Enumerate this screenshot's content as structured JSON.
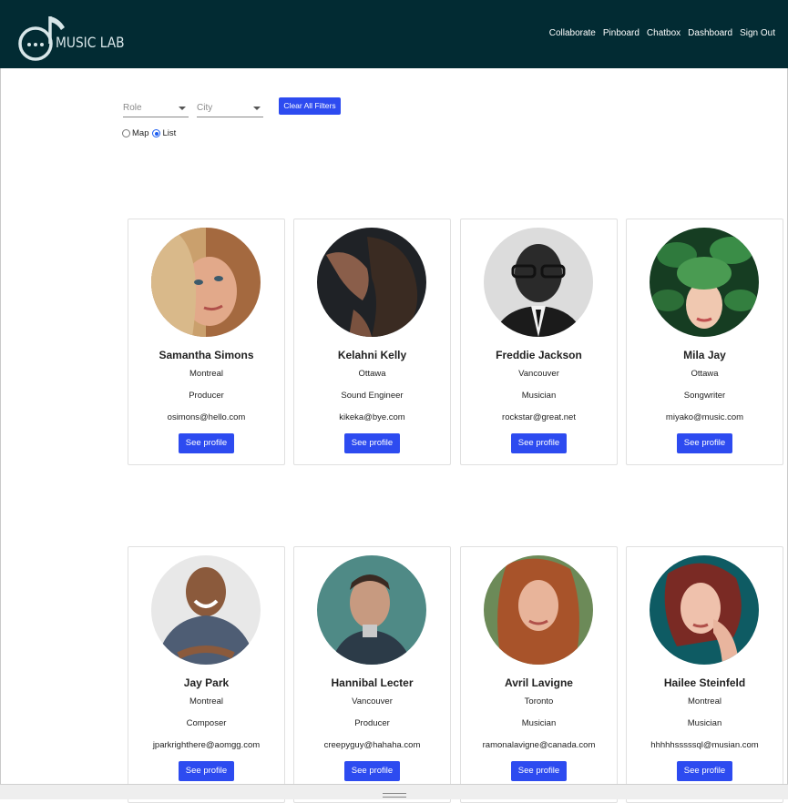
{
  "brand": {
    "name": "MUSIC LAB"
  },
  "nav": [
    {
      "label": "Collaborate"
    },
    {
      "label": "Pinboard"
    },
    {
      "label": "Chatbox"
    },
    {
      "label": "Dashboard"
    },
    {
      "label": "Sign Out"
    }
  ],
  "filters": {
    "role_label": "Role",
    "city_label": "City",
    "clear_label": "Clear All Filters",
    "view_options": [
      {
        "label": "Map",
        "selected": false
      },
      {
        "label": "List",
        "selected": true
      }
    ]
  },
  "cards": [
    {
      "name": "Samantha Simons",
      "city": "Montreal",
      "role": "Producer",
      "email": "osimons@hello.com",
      "button": "See profile"
    },
    {
      "name": "Kelahni Kelly",
      "city": "Ottawa",
      "role": "Sound Engineer",
      "email": "kikeka@bye.com",
      "button": "See profile"
    },
    {
      "name": "Freddie Jackson",
      "city": "Vancouver",
      "role": "Musician",
      "email": "rockstar@great.net",
      "button": "See profile"
    },
    {
      "name": "Mila Jay",
      "city": "Ottawa",
      "role": "Songwriter",
      "email": "miyako@music.com",
      "button": "See profile"
    },
    {
      "name": "Jay Park",
      "city": "Montreal",
      "role": "Composer",
      "email": "jparkrighthere@aomgg.com",
      "button": "See profile"
    },
    {
      "name": "Hannibal Lecter",
      "city": "Vancouver",
      "role": "Producer",
      "email": "creepyguy@hahaha.com",
      "button": "See profile"
    },
    {
      "name": "Avril Lavigne",
      "city": "Toronto",
      "role": "Musician",
      "email": "ramonalavigne@canada.com",
      "button": "See profile"
    },
    {
      "name": "Hailee Steinfeld",
      "city": "Montreal",
      "role": "Musician",
      "email": "hhhhhsssssql@musian.com",
      "button": "See profile"
    }
  ],
  "colors": {
    "navbar": "#022b33",
    "accent_button": "#2d4bf0"
  }
}
